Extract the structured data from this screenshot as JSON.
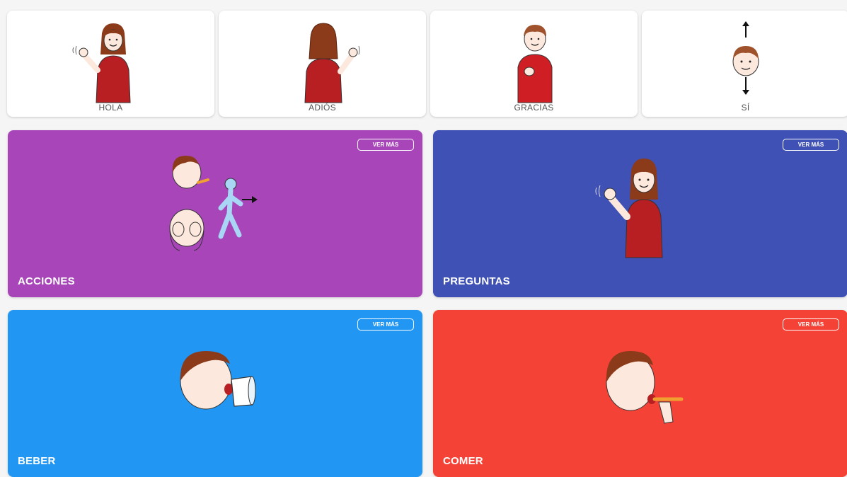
{
  "quick_phrases": [
    {
      "label": "HOLA",
      "icon": "girl-waving-icon"
    },
    {
      "label": "ADIÓS",
      "icon": "girl-waving-back-icon"
    },
    {
      "label": "GRACIAS",
      "icon": "boy-thanks-icon"
    },
    {
      "label": "SÍ",
      "icon": "head-nod-yes-icon"
    }
  ],
  "categories": [
    {
      "title": "ACCIONES",
      "button": "VER MÁS",
      "color": "#a846b9",
      "icon": "actions-icon"
    },
    {
      "title": "PREGUNTAS",
      "button": "VER MÁS",
      "color": "#3f51b5",
      "icon": "girl-waving-icon"
    },
    {
      "title": "BEBER",
      "button": "VER MÁS",
      "color": "#2196f3",
      "icon": "drinking-icon"
    },
    {
      "title": "COMER",
      "button": "VER MÁS",
      "color": "#f44336",
      "icon": "eating-icon"
    }
  ],
  "colors": {
    "background": "#f5f5f5",
    "card": "#ffffff",
    "shirt_red": "#b81f23",
    "hair_brown": "#8b3a1a",
    "skin": "#fce8dc"
  }
}
